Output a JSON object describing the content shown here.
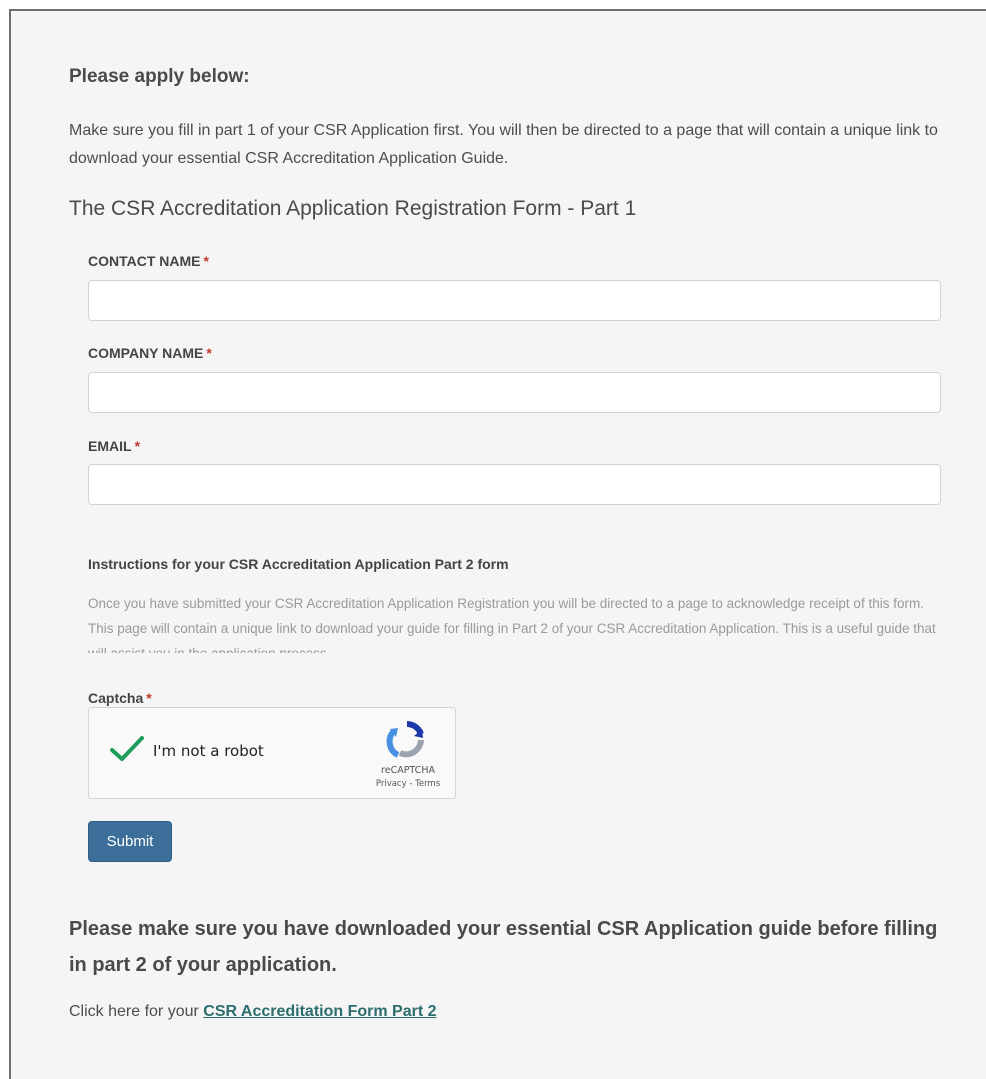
{
  "page": {
    "heading": "Please apply below:",
    "intro": "Make sure you fill in part 1 of your CSR Application first. You will then be directed to a page that will contain a unique link to download your essential CSR Accreditation Application Guide.",
    "form_title": "The CSR Accreditation Application Registration Form - Part 1"
  },
  "form": {
    "required_marker": "*",
    "contact_name": {
      "label": "CONTACT NAME",
      "value": ""
    },
    "company_name": {
      "label": "COMPANY NAME",
      "value": ""
    },
    "email": {
      "label": "EMAIL",
      "value": ""
    },
    "instructions": {
      "title": "Instructions for your CSR Accreditation Application Part 2 form",
      "body": "Once you have submitted your CSR Accreditation Application Registration you will be directed to a page to acknowledge receipt of this form. This page will contain a unique link to download your guide for filling in Part 2 of your CSR Accreditation Application. This is a useful guide that will assist you in the application process."
    },
    "captcha": {
      "label": "Captcha",
      "checkbox_text": "I'm not a robot",
      "checked": true,
      "brand": "reCAPTCHA",
      "links": "Privacy - Terms"
    },
    "submit_label": "Submit"
  },
  "footer": {
    "notice": "Please make sure you have downloaded your essential CSR Application guide before filling in part 2 of your application.",
    "click_prefix": "Click here for your ",
    "link_text": "CSR Accreditation Form Part 2"
  },
  "colors": {
    "background": "#f5f5f6",
    "submit_button": "#3b6e99",
    "required_asterisk": "#c0392b",
    "checkmark": "#1e9e5a",
    "link": "#2c6e6e"
  }
}
